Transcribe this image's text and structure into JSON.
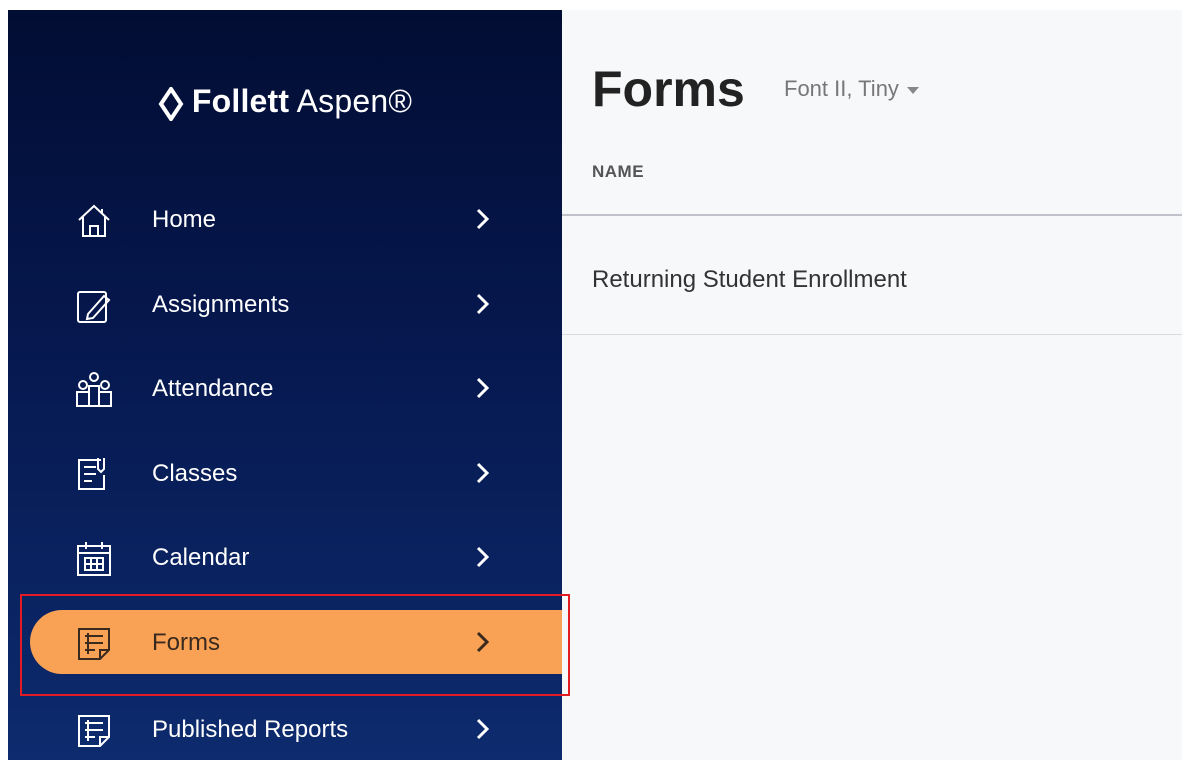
{
  "brand": {
    "logo": "follett-logo-icon",
    "strong": "Follett",
    "rest": " Aspen®"
  },
  "sidebar": {
    "items": [
      {
        "label": "Home",
        "icon": "home-icon"
      },
      {
        "label": "Assignments",
        "icon": "pencil-note-icon"
      },
      {
        "label": "Attendance",
        "icon": "people-icon"
      },
      {
        "label": "Classes",
        "icon": "classes-icon"
      },
      {
        "label": "Calendar",
        "icon": "calendar-icon"
      },
      {
        "label": "Forms",
        "icon": "forms-icon",
        "active": true
      },
      {
        "label": "Published Reports",
        "icon": "reports-icon"
      }
    ]
  },
  "main": {
    "title": "Forms",
    "subtitle": "Font II, Tiny",
    "column_header": "NAME",
    "rows": [
      {
        "name": "Returning Student Enrollment"
      }
    ]
  },
  "colors": {
    "active": "#f9a256",
    "sidebar": "#06184f",
    "highlight": "#e31b23"
  }
}
